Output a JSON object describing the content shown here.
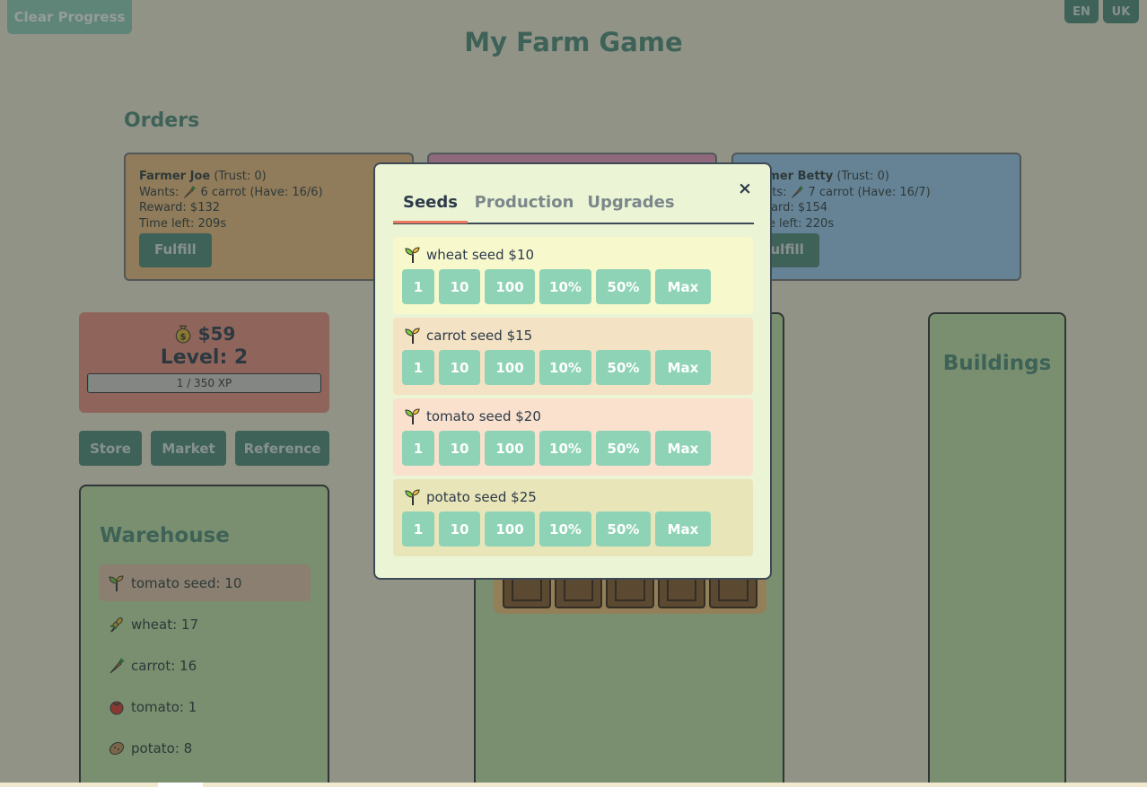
{
  "header": {
    "clear_progress": "Clear Progress",
    "lang_en": "EN",
    "lang_uk": "UK",
    "title": "My Farm Game"
  },
  "orders": {
    "title": "Orders",
    "items": [
      {
        "farmer": "Farmer Joe",
        "trust": "(Trust: 0)",
        "wants": "Wants:",
        "item": "6 carrot (Have: 16/6)",
        "reward": "Reward: $132",
        "time": "Time left: 209s",
        "button": "Fulfill"
      },
      {
        "farmer": "",
        "trust": "",
        "wants": "",
        "item": "",
        "reward": "",
        "time": "",
        "button": ""
      },
      {
        "farmer": "Farmer Betty",
        "trust": "(Trust: 0)",
        "wants": "Wants:",
        "item": "7 carrot (Have: 16/7)",
        "reward": "Reward: $154",
        "time": "Time left: 220s",
        "button": "Fulfill"
      }
    ]
  },
  "player": {
    "money": "$59",
    "level": "Level: 2",
    "xp": "1 / 350 XP",
    "xp_fraction": 0.003
  },
  "nav": {
    "store": "Store",
    "market": "Market",
    "reference": "Reference"
  },
  "warehouse": {
    "title": "Warehouse",
    "items": [
      {
        "icon": "sprout-icon",
        "label": "tomato seed: 10",
        "selected": true
      },
      {
        "icon": "wheat-icon",
        "label": "wheat: 17"
      },
      {
        "icon": "carrot-icon",
        "label": "carrot: 16"
      },
      {
        "icon": "tomato-icon",
        "label": "tomato: 1"
      },
      {
        "icon": "potato-icon",
        "label": "potato: 8"
      }
    ]
  },
  "buildings": {
    "title": "Buildings"
  },
  "store_modal": {
    "tabs": [
      "Seeds",
      "Production",
      "Upgrades"
    ],
    "active_tab": "Seeds",
    "close": "×",
    "seeds": [
      {
        "icon": "sprout-icon",
        "label": "wheat seed $10",
        "bg": "#f7f8cc"
      },
      {
        "icon": "sprout-icon",
        "label": "carrot seed $15",
        "bg": "#f3e2c3"
      },
      {
        "icon": "sprout-icon",
        "label": "tomato seed $20",
        "bg": "#f9e1cd"
      },
      {
        "icon": "sprout-icon",
        "label": "potato seed $25",
        "bg": "#e8e5b8"
      }
    ],
    "quantities": [
      "1",
      "10",
      "100",
      "10%",
      "50%",
      "Max"
    ]
  },
  "colors": {
    "accent": "#4f8d77",
    "button": "#8ed3b6",
    "active_tab_underline": "#e97a5f"
  }
}
